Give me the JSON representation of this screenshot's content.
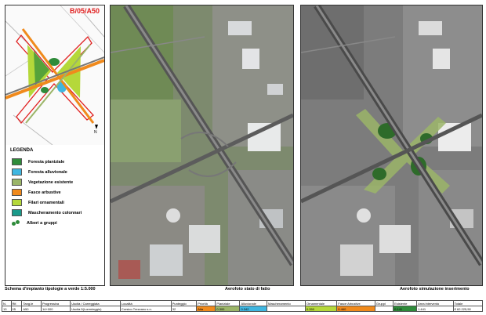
{
  "map_code": "B/05/A50",
  "legend": {
    "title": "LEGENDA",
    "items": [
      {
        "label": "Foresta planiziale",
        "color": "#2e8b3a"
      },
      {
        "label": "Foresta alluvionale",
        "color": "#3fb6e0"
      },
      {
        "label": "Vegetazione esistente",
        "color": "#9bb568"
      },
      {
        "label": "Fasce arbustive",
        "color": "#f08a1c"
      },
      {
        "label": "Filari ornamentali",
        "color": "#b5d83a"
      },
      {
        "label": "Mascheramento colonnari",
        "color": "#1a9a8a"
      },
      {
        "label": "Alberi a gruppi",
        "color": "#2e8b3a"
      }
    ]
  },
  "captions": {
    "schema": "Schema d'impianto tipologie a verde 1:5.000",
    "stato": "Aerofoto stato di fatto",
    "simulazione": "Aerofoto simulazione inserimento"
  },
  "table": {
    "headers": [
      "N.",
      "Rif.",
      "Tang.le",
      "Progressiva",
      "Uscita / Carreggiata",
      "Località",
      "Punteggio",
      "Priorità",
      "Planiziale",
      "Alluvionale",
      "Mascheramento",
      "Ornamentale",
      "Fasce Arbustive",
      "Gruppi",
      "Esistente",
      "Area intervento",
      "Totale"
    ],
    "values": [
      "13",
      "05",
      "A50",
      "14+000",
      "Uscita 5(Lorenteggio)",
      "Corsico-Trezzano s.n.",
      "32",
      "Alta",
      "0.300",
      "0.342",
      "",
      "0.350",
      "0.460",
      "",
      "0.141",
      "1.441",
      "€ 62.225,50"
    ],
    "highlight": {
      "7": "#f08a1c",
      "8": "#9bb568",
      "9": "#3fb6e0",
      "11": "#b5d83a",
      "12": "#f08a1c",
      "14": "#2e8b3a"
    }
  }
}
